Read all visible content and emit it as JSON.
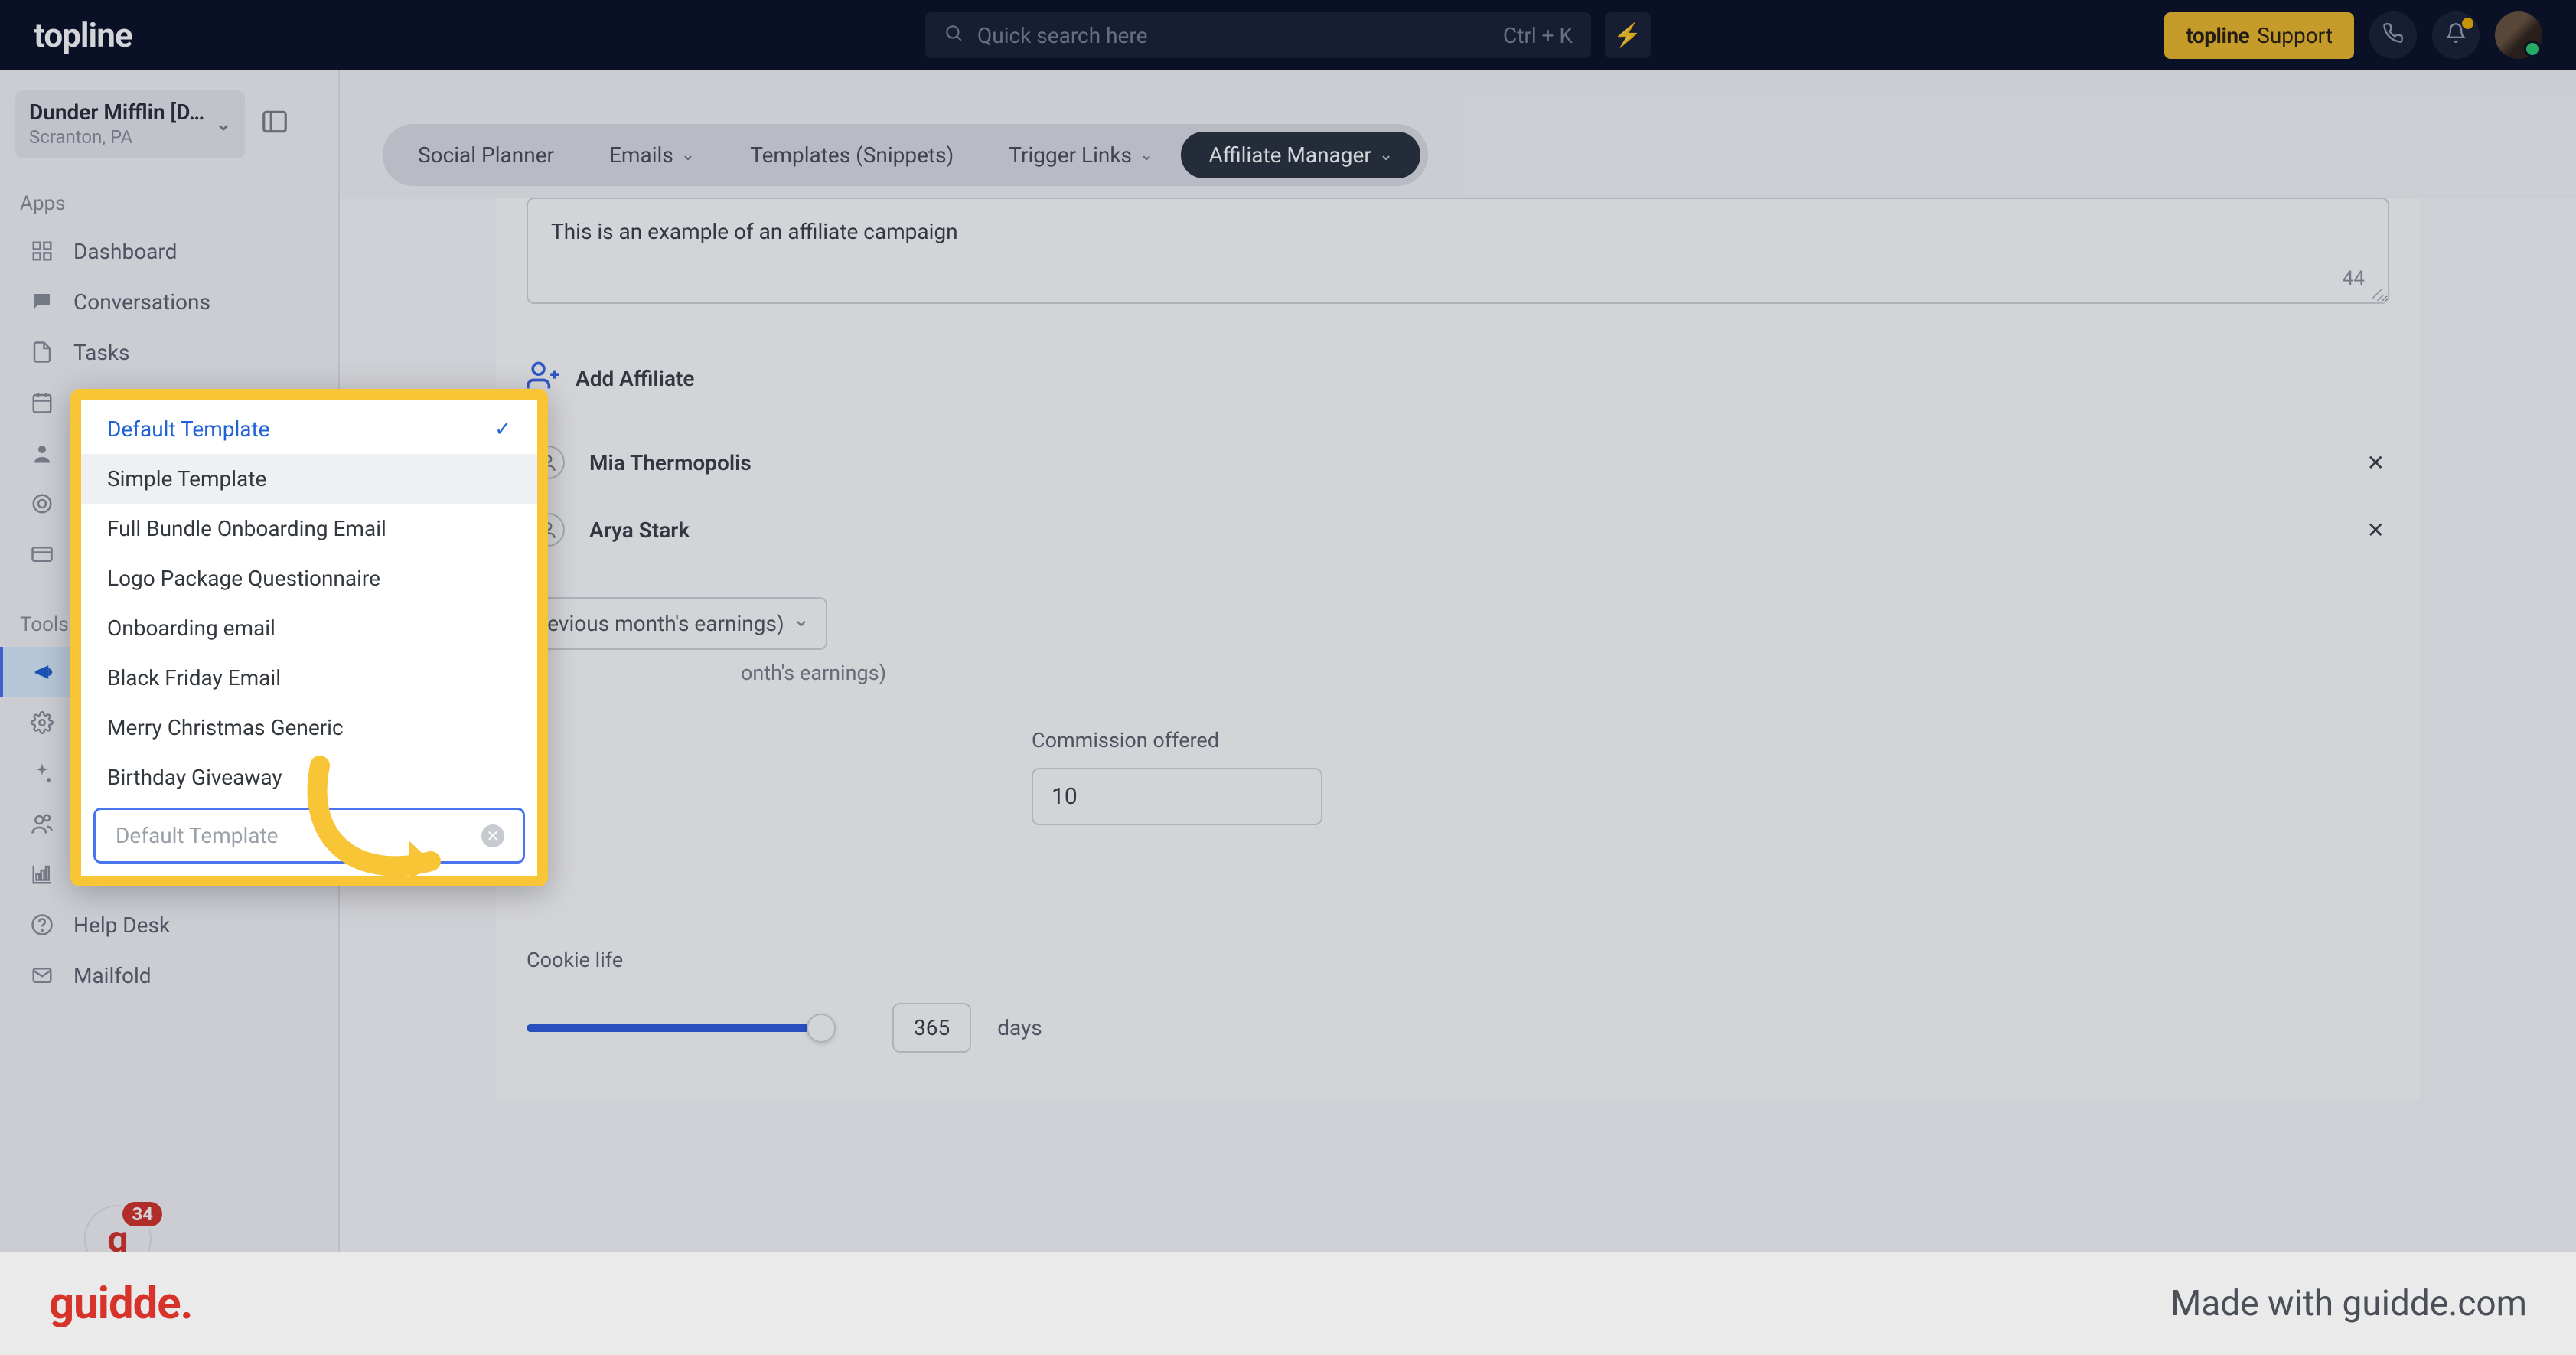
{
  "header": {
    "logo": "topline",
    "search_placeholder": "Quick search here",
    "search_kbd": "Ctrl + K",
    "support_brand": "topline",
    "support_label": "Support"
  },
  "org": {
    "name": "Dunder Mifflin [D…",
    "location": "Scranton, PA"
  },
  "sidebar": {
    "section_apps": "Apps",
    "section_tools": "Tools",
    "apps": [
      {
        "label": "Dashboard",
        "icon": "grid"
      },
      {
        "label": "Conversations",
        "icon": "chat"
      },
      {
        "label": "Tasks",
        "icon": "file"
      },
      {
        "label": "Calendars",
        "icon": "calendar"
      },
      {
        "label": "Contacts",
        "icon": "person"
      },
      {
        "label": "Opportunities",
        "icon": "target"
      },
      {
        "label": "Payments",
        "icon": "card"
      }
    ],
    "tools": [
      {
        "label": "Marketing",
        "icon": "megaphone",
        "active": true
      },
      {
        "label": "Automation",
        "icon": "gear"
      },
      {
        "label": "Sites",
        "icon": "sparkle"
      },
      {
        "label": "Memberships",
        "icon": "people"
      },
      {
        "label": "Reporting",
        "icon": "chart"
      },
      {
        "label": "Help Desk",
        "icon": "help"
      },
      {
        "label": "Mailfold",
        "icon": "mail"
      }
    ],
    "badge_count": "34"
  },
  "tabs": {
    "items": [
      {
        "label": "Social Planner",
        "caret": false
      },
      {
        "label": "Emails",
        "caret": true
      },
      {
        "label": "Templates (Snippets)",
        "caret": false
      },
      {
        "label": "Trigger Links",
        "caret": true
      },
      {
        "label": "Affiliate Manager",
        "caret": true,
        "active": true
      }
    ]
  },
  "form": {
    "desc_value": "This is an example of an affiliate campaign",
    "desc_count": "44",
    "add_affiliate_label": "Add Affiliate",
    "affiliates": [
      "Mia Thermopolis",
      "Arya Stark"
    ],
    "payout_fragment": "revious month's earnings)",
    "payout_subtext_fragment": "onth's earnings)",
    "commission_label": "Commission offered",
    "commission_value": "10",
    "cookie_label": "Cookie life",
    "cookie_value": "365",
    "cookie_unit": "days"
  },
  "dropdown": {
    "options": [
      {
        "label": "Default Template",
        "selected": true
      },
      {
        "label": "Simple Template",
        "hover": true
      },
      {
        "label": "Full Bundle Onboarding Email"
      },
      {
        "label": "Logo Package Questionnaire"
      },
      {
        "label": "Onboarding email"
      },
      {
        "label": "Black Friday Email"
      },
      {
        "label": "Merry Christmas Generic"
      },
      {
        "label": "Birthday Giveaway"
      }
    ],
    "search_placeholder": "Default Template"
  },
  "footer": {
    "logo": "guidde.",
    "madewith": "Made with guidde.com"
  }
}
